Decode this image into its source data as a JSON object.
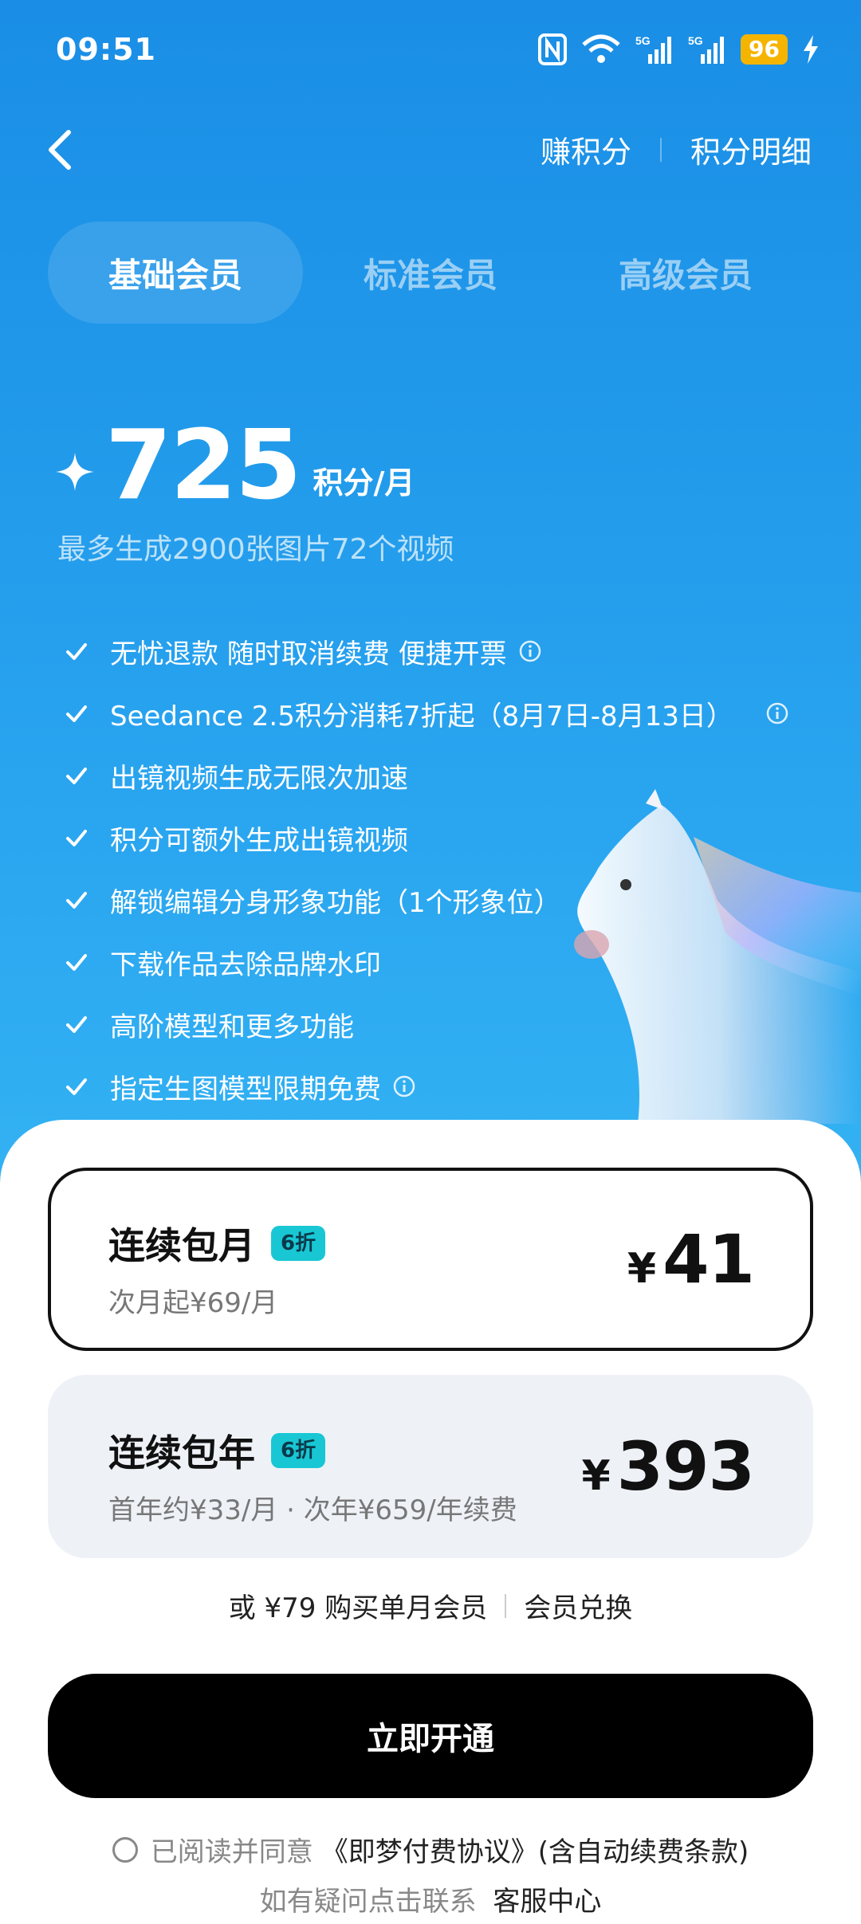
{
  "status_bar": {
    "time": "09:51",
    "battery": "96",
    "network_labels": [
      "5G",
      "5G"
    ]
  },
  "nav": {
    "earn_points": "赚积分",
    "points_detail": "积分明细"
  },
  "tabs": [
    {
      "label": "基础会员",
      "active": true
    },
    {
      "label": "标准会员",
      "active": false
    },
    {
      "label": "高级会员",
      "active": false
    }
  ],
  "points": {
    "value": "725",
    "unit": "积分/月",
    "subtitle": "最多生成2900张图片72个视频"
  },
  "features": [
    {
      "text": "无忧退款 随时取消续费 便捷开票",
      "info": true
    },
    {
      "text": "Seedance 2.5积分消耗7折起（8月7日-8月13日）",
      "info": true
    },
    {
      "text": "出镜视频生成无限次加速",
      "info": false
    },
    {
      "text": "积分可额外生成出镜视频",
      "info": false
    },
    {
      "text": "解锁编辑分身形象功能（1个形象位）",
      "info": false
    },
    {
      "text": "下载作品去除品牌水印",
      "info": false
    },
    {
      "text": "高阶模型和更多功能",
      "info": false
    },
    {
      "text": "指定生图模型限期免费",
      "info": true
    }
  ],
  "plans": [
    {
      "title": "连续包月",
      "badge": "6折",
      "sub": "次月起¥69/月",
      "currency": "¥",
      "price": "41",
      "selected": true
    },
    {
      "title": "连续包年",
      "badge": "6折",
      "sub": "首年约¥33/月 · 次年¥659/年续费",
      "currency": "¥",
      "price": "393",
      "selected": false
    }
  ],
  "alt": {
    "single_month": "或 ¥79 购买单月会员",
    "redeem": "会员兑换"
  },
  "cta": {
    "label": "立即开通"
  },
  "agreement": {
    "prefix": "已阅读并同意",
    "link": "《即梦付费协议》(含自动续费条款)"
  },
  "help": {
    "prefix": "如有疑问点击联系",
    "link": "客服中心"
  },
  "colors": {
    "hero_top": "#1a8ee6",
    "hero_bottom": "#33b2f3",
    "badge": "#19c7d4",
    "battery": "#f5b400",
    "cta": "#000000"
  }
}
